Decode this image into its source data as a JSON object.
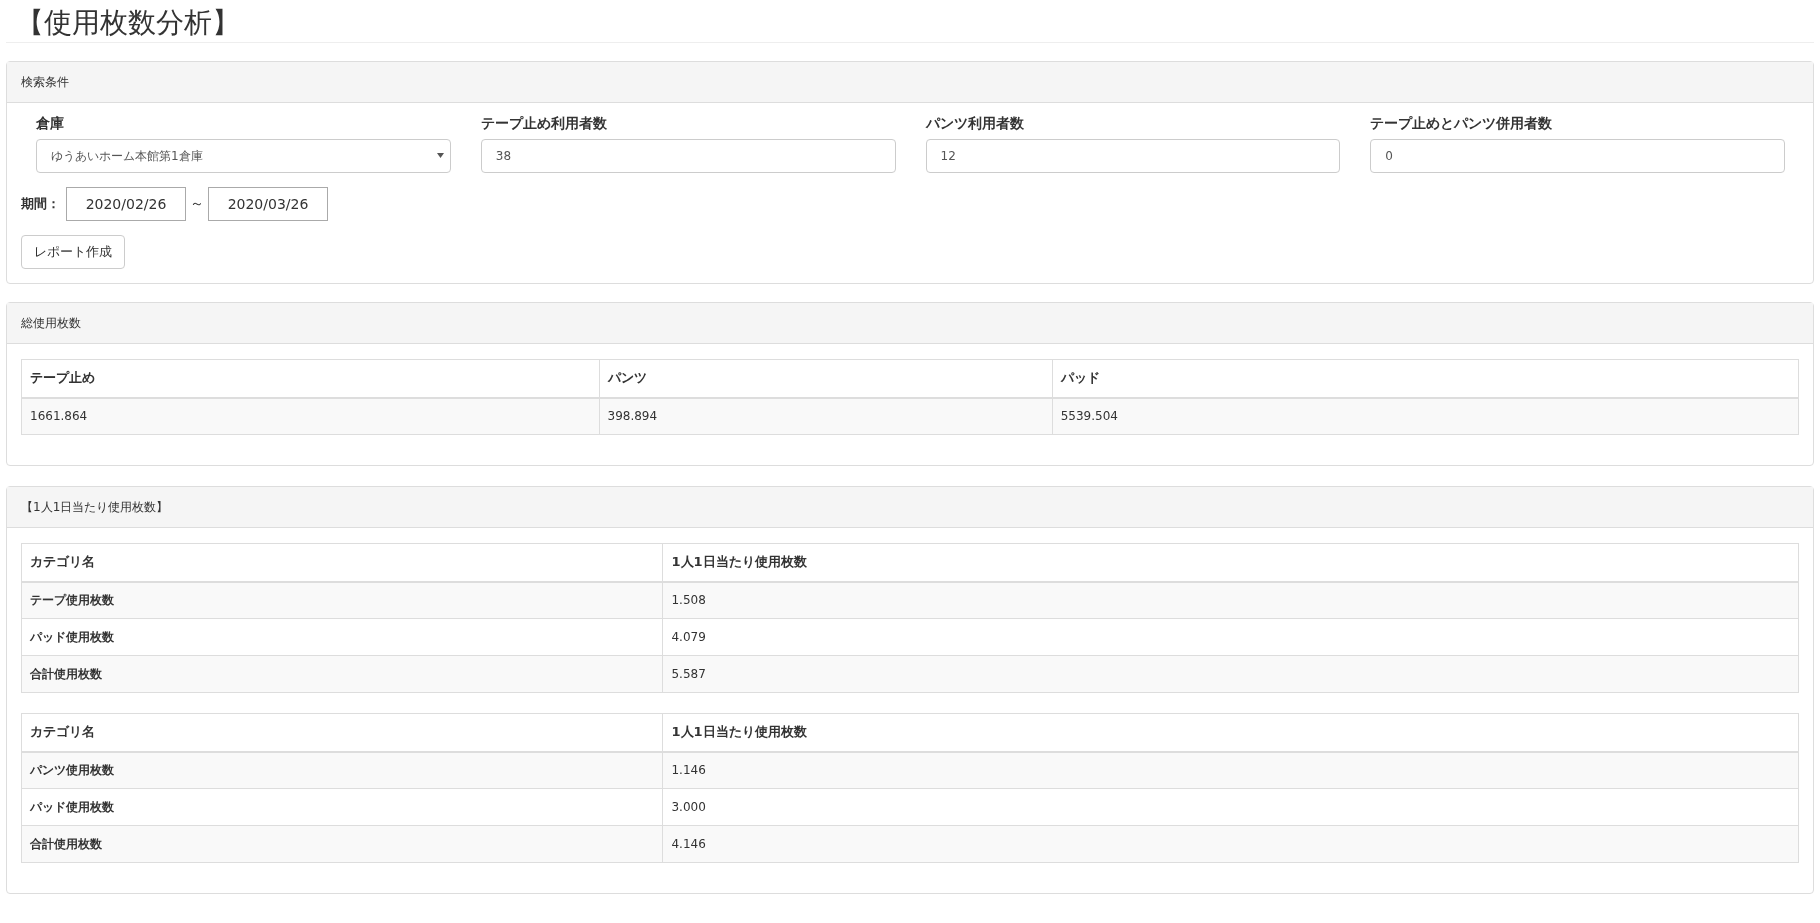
{
  "page_title": "【使用枚数分析】",
  "search_panel": {
    "title": "検索条件",
    "fields": [
      {
        "kind": "select",
        "label": "倉庫",
        "value": "ゆうあいホーム本館第1倉庫"
      },
      {
        "kind": "input",
        "label": "テープ止め利用者数",
        "value": "38"
      },
      {
        "kind": "input",
        "label": "パンツ利用者数",
        "value": "12"
      },
      {
        "kind": "input",
        "label": "テープ止めとパンツ併用者数",
        "value": "0"
      }
    ],
    "period": {
      "label": "期間：",
      "from": "2020/02/26",
      "separator": "～",
      "to": "2020/03/26"
    },
    "button": "レポート作成"
  },
  "total_panel": {
    "title": "総使用枚数",
    "columns": [
      "テープ止め",
      "パンツ",
      "パッド"
    ],
    "rows": [
      [
        "1661.864",
        "398.894",
        "5539.504"
      ]
    ]
  },
  "per_person_panel": {
    "title": "【1人1日当たり使用枚数】",
    "tables": [
      {
        "columns": [
          "カテゴリ名",
          "1人1日当たり使用枚数"
        ],
        "rows": [
          [
            "テープ使用枚数",
            "1.508"
          ],
          [
            "パッド使用枚数",
            "4.079"
          ],
          [
            "合計使用枚数",
            "5.587"
          ]
        ]
      },
      {
        "columns": [
          "カテゴリ名",
          "1人1日当たり使用枚数"
        ],
        "rows": [
          [
            "パンツ使用枚数",
            "1.146"
          ],
          [
            "パッド使用枚数",
            "3.000"
          ],
          [
            "合計使用枚数",
            "4.146"
          ]
        ]
      }
    ]
  }
}
